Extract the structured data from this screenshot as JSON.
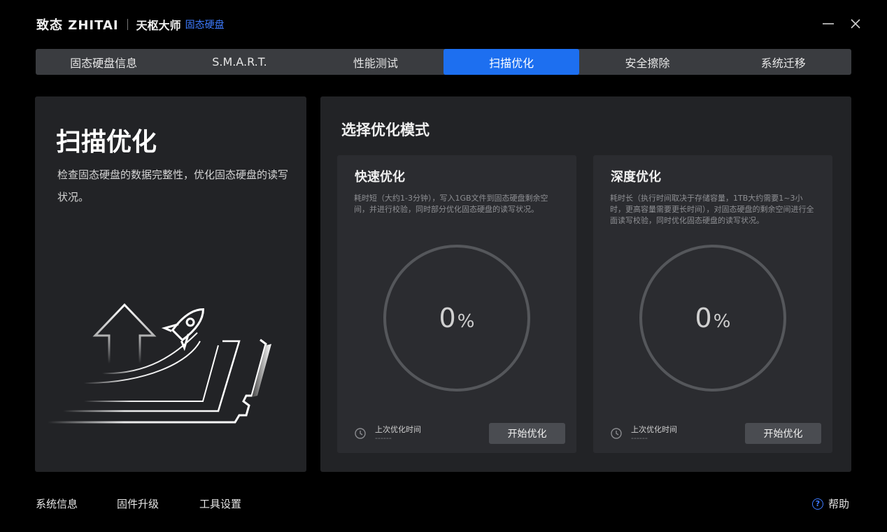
{
  "window": {
    "brand_logo": "致态 ZHITAI",
    "product": "天枢大师",
    "product_sub": "固态硬盘"
  },
  "tabs": [
    {
      "label": "固态硬盘信息"
    },
    {
      "label": "S.M.A.R.T."
    },
    {
      "label": "性能测试"
    },
    {
      "label": "扫描优化",
      "active": true
    },
    {
      "label": "安全擦除"
    },
    {
      "label": "系统迁移"
    }
  ],
  "intro": {
    "title": "扫描优化",
    "description": "检查固态硬盘的数据完整性，优化固态硬盘的读写状况。"
  },
  "modes": {
    "title": "选择优化模式",
    "quick": {
      "title": "快速优化",
      "description": "耗时短（大约1-3分钟），写入1GB文件到固态硬盘剩余空间，并进行校验，同时部分优化固态硬盘的读写状况。",
      "progress_value": "0",
      "progress_unit": "%",
      "last_label": "上次优化时间",
      "last_value": "------",
      "start_label": "开始优化"
    },
    "deep": {
      "title": "深度优化",
      "description": "耗时长（执行时间取决于存储容量，1TB大约需要1~3小时，更高容量需要更长时间），对固态硬盘的剩余空间进行全面读写校验，同时优化固态硬盘的读写状况。",
      "progress_value": "0",
      "progress_unit": "%",
      "last_label": "上次优化时间",
      "last_value": "------",
      "start_label": "开始优化"
    }
  },
  "footer": {
    "system_info": "系统信息",
    "firmware_upgrade": "固件升级",
    "tool_settings": "工具设置",
    "help_label": "帮助"
  },
  "colors": {
    "accent": "#1d6ff0",
    "brand_blue": "#3d7bff",
    "panel_bg": "#222326",
    "card_bg": "#2b2c30"
  }
}
